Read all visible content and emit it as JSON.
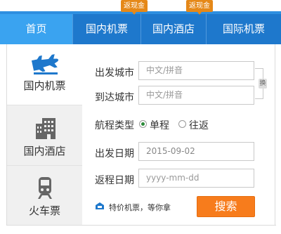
{
  "nav": {
    "items": [
      {
        "label": "首页"
      },
      {
        "label": "国内机票",
        "badge": "返现金"
      },
      {
        "label": "国内酒店",
        "badge": "返现金"
      },
      {
        "label": "国际机票"
      }
    ]
  },
  "side": {
    "tabs": [
      {
        "label": "国内机票",
        "icon": "airplane-icon"
      },
      {
        "label": "国内酒店",
        "icon": "hotel-building-icon"
      },
      {
        "label": "火车票",
        "icon": "train-icon"
      }
    ]
  },
  "form": {
    "departure_label": "出发城市",
    "departure_placeholder": "中文/拼音",
    "arrival_label": "到达城市",
    "arrival_placeholder": "中文/拼音",
    "swap_label": "换",
    "trip_type_label": "航程类型",
    "one_way_label": "单程",
    "round_trip_label": "往返",
    "depart_date_label": "出发日期",
    "depart_date_value": "2015-09-02",
    "return_date_label": "返程日期",
    "return_date_placeholder": "yyyy-mm-dd",
    "promo_text": "特价机票，等你拿",
    "search_label": "搜索"
  },
  "colors": {
    "nav_bg": "#1e78cc",
    "nav_active": "#3aa3f0",
    "badge": "#e58818",
    "search_button": "#f77c1c"
  }
}
